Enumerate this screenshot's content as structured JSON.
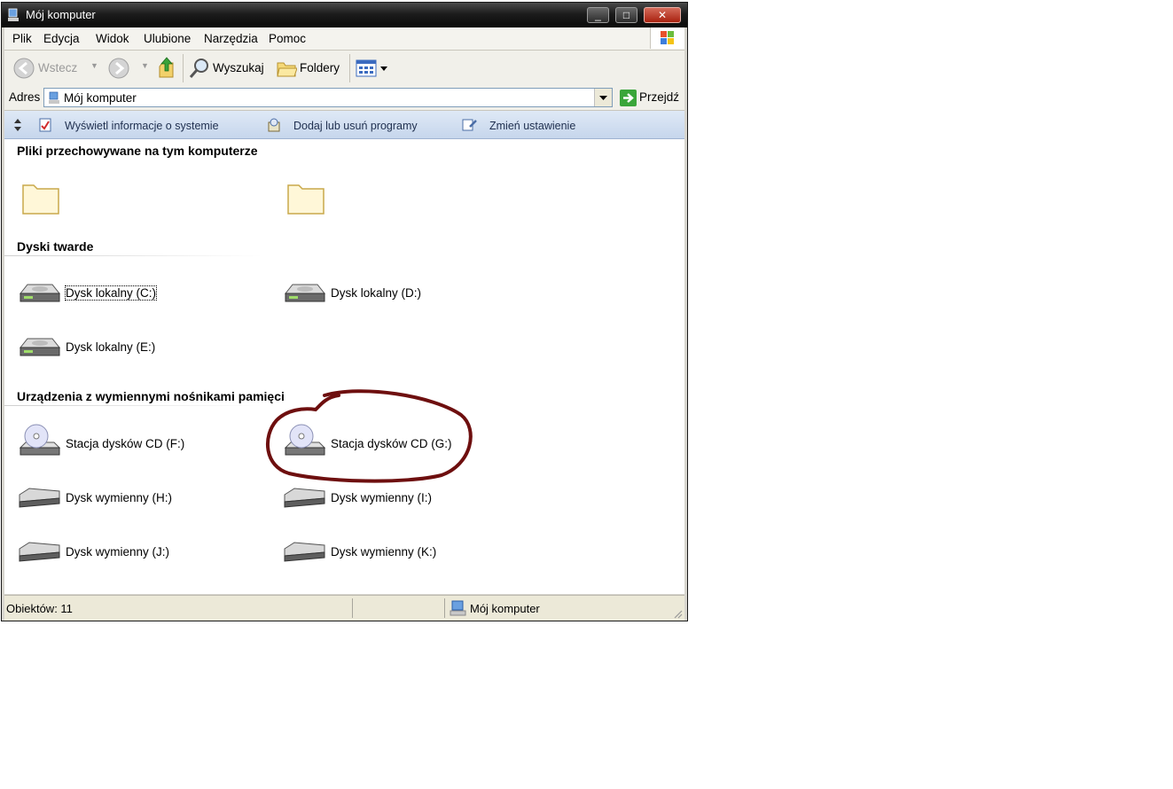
{
  "window": {
    "title": "Mój komputer",
    "controls": {
      "minimize": "_",
      "maximize": "□",
      "close": "✕"
    }
  },
  "menu": [
    "Plik",
    "Edycja",
    "Widok",
    "Ulubione",
    "Narzędzia",
    "Pomoc"
  ],
  "toolbar": {
    "back_label": "Wstecz",
    "search_label": "Wyszukaj",
    "folders_label": "Foldery"
  },
  "address": {
    "label": "Adres",
    "value": "Mój komputer",
    "go_label": "Przejdź"
  },
  "tasks": [
    "Wyświetl informacje o systemie",
    "Dodaj lub usuń programy",
    "Zmień ustawienie"
  ],
  "groups": {
    "files": {
      "title": "Pliki przechowywane na tym komputerze"
    },
    "hard_drives": {
      "title": "Dyski twarde",
      "items": [
        "Dysk lokalny (C:)",
        "Dysk lokalny (D:)",
        "Dysk lokalny (E:)"
      ]
    },
    "removable": {
      "title": "Urządzenia z wymiennymi nośnikami pamięci",
      "items": [
        "Stacja dysków CD (F:)",
        "Stacja dysków CD (G:)",
        "Dysk wymienny (H:)",
        "Dysk wymienny (I:)",
        "Dysk wymienny (J:)",
        "Dysk wymienny (K:)"
      ]
    }
  },
  "status": {
    "count": "Obiektów: 11",
    "location": "Mój komputer"
  },
  "colors": {
    "annotation_circle": "#6e0f0f",
    "titlebar": "#1c1c1c",
    "task_pane": "#c6d6ec"
  }
}
